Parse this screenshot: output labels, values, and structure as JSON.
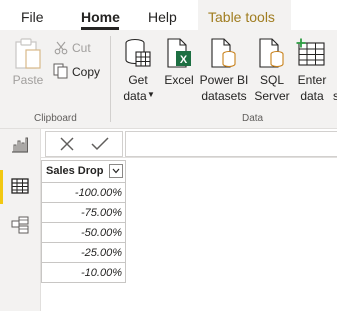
{
  "tabs": {
    "file": "File",
    "home": "Home",
    "help": "Help",
    "table_tools": "Table tools"
  },
  "clipboard": {
    "paste": "Paste",
    "cut": "Cut",
    "copy": "Copy",
    "group_label": "Clipboard"
  },
  "data_group": {
    "get_data_line1": "Get",
    "get_data_line2": "data",
    "excel": "Excel",
    "powerbi_line1": "Power BI",
    "powerbi_line2": "datasets",
    "sql_line1": "SQL",
    "sql_line2": "Server",
    "enter_line1": "Enter",
    "enter_line2": "data",
    "overflow_letter": "s",
    "group_label": "Data"
  },
  "table": {
    "column_header": "Sales Drop",
    "rows": [
      "-100.00%",
      "-75.00%",
      "-50.00%",
      "-25.00%",
      "-10.00%"
    ]
  },
  "colors": {
    "accent_yellow": "#f2c811",
    "table_tools_text": "#a07d20",
    "excel_green": "#1d6f42",
    "disabled_gray": "#a19f9d"
  }
}
